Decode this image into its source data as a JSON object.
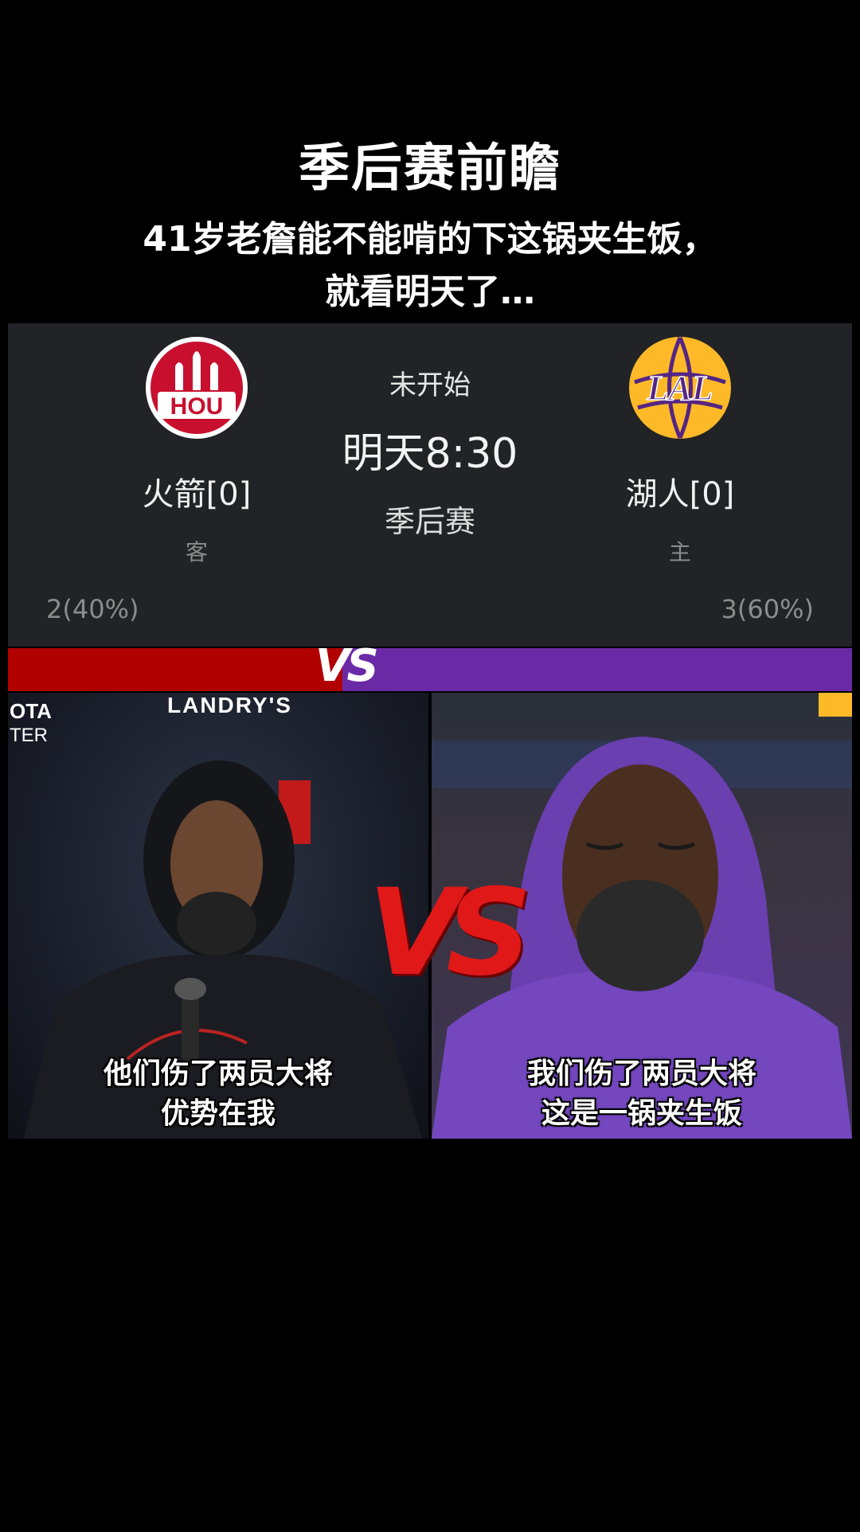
{
  "header": {
    "title": "季后赛前瞻",
    "subtitle_line1": "41岁老詹能不能啃的下这锅夹生饭，",
    "subtitle_line2": "就看明天了…"
  },
  "match": {
    "status": "未开始",
    "time": "明天8:30",
    "stage": "季后赛",
    "away": {
      "logo_text": "HOU",
      "name": "火箭[0]",
      "role": "客",
      "vote": "2(40%)",
      "vote_share": 0.4,
      "color": "#c8102e"
    },
    "home": {
      "logo_text": "LAL",
      "name": "湖人[0]",
      "role": "主",
      "vote": "3(60%)",
      "vote_share": 0.6,
      "color": "#fdb927"
    }
  },
  "vs_bar": {
    "label": "VS",
    "left_color": "#b00000",
    "right_color": "#6a2aa6"
  },
  "photos": {
    "left": {
      "sign_top": "LANDRY'S",
      "sign_left": "OTA",
      "sign_left2": "TER",
      "caption_line1": "他们伤了两员大将",
      "caption_line2": "优势在我"
    },
    "right": {
      "caption_line1": "我们伤了两员大将",
      "caption_line2": "这是一锅夹生饭"
    },
    "center_vs": "VS"
  }
}
